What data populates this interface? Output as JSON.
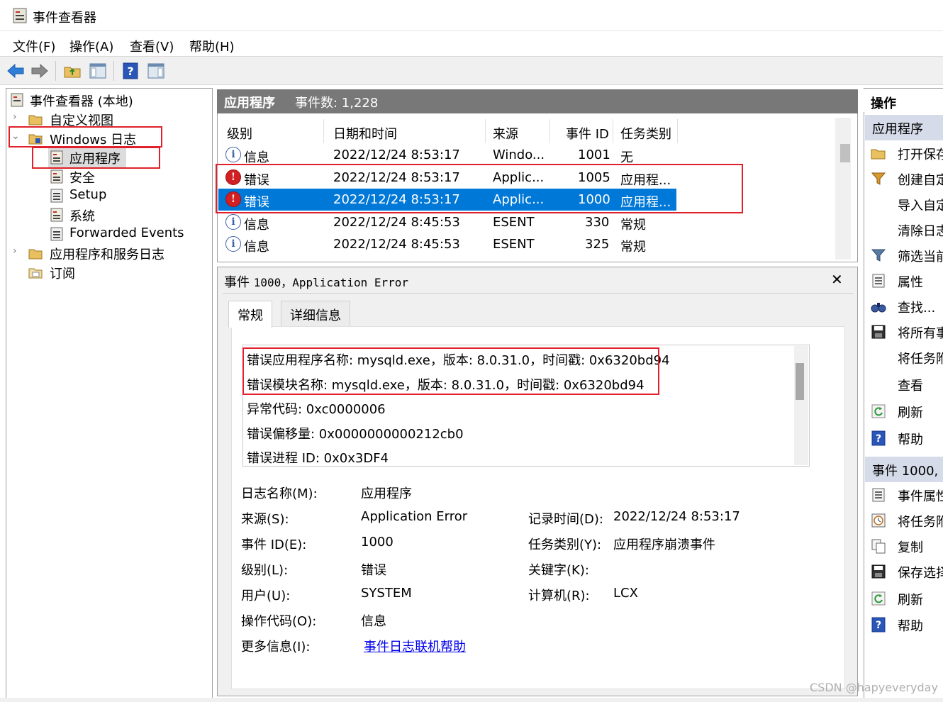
{
  "window": {
    "title": "事件查看器"
  },
  "menu": [
    "文件(F)",
    "操作(A)",
    "查看(V)",
    "帮助(H)"
  ],
  "toolbar": [
    "back-icon",
    "forward-icon",
    "up-folder-icon",
    "show-hide-console-tree-icon",
    "help-icon",
    "show-hide-action-pane-icon"
  ],
  "tree": {
    "root": "事件查看器 (本地)",
    "custom_views": "自定义视图",
    "windows_logs": "Windows 日志",
    "application": "应用程序",
    "security": "安全",
    "setup": "Setup",
    "system": "系统",
    "forwarded": "Forwarded Events",
    "app_service_logs": "应用程序和服务日志",
    "subscriptions": "订阅"
  },
  "list": {
    "title": "应用程序",
    "count": "事件数: 1,228",
    "columns": {
      "level": "级别",
      "datetime": "日期和时间",
      "source": "来源",
      "event_id": "事件 ID",
      "task": "任务类别"
    },
    "rows": [
      {
        "level": "信息",
        "datetime": "2022/12/24 8:53:17",
        "source": "Windo...",
        "event_id": "1001",
        "task": "无"
      },
      {
        "level": "错误",
        "datetime": "2022/12/24 8:53:17",
        "source": "Applic...",
        "event_id": "1005",
        "task": "应用程..."
      },
      {
        "level": "错误",
        "datetime": "2022/12/24 8:53:17",
        "source": "Applic...",
        "event_id": "1000",
        "task": "应用程..."
      },
      {
        "level": "信息",
        "datetime": "2022/12/24 8:45:53",
        "source": "ESENT",
        "event_id": "330",
        "task": "常规"
      },
      {
        "level": "信息",
        "datetime": "2022/12/24 8:45:53",
        "source": "ESENT",
        "event_id": "325",
        "task": "常规"
      }
    ]
  },
  "detail": {
    "title_prefix": "事件 ",
    "title_mono": "1000，Application Error",
    "tabs": {
      "general": "常规",
      "details": "详细信息"
    },
    "description": [
      "错误应用程序名称: mysqld.exe，版本: 8.0.31.0，时间戳: 0x6320bd94",
      "错误模块名称: mysqld.exe，版本: 8.0.31.0，时间戳: 0x6320bd94",
      "异常代码: 0xc0000006",
      "错误偏移量: 0x0000000000212cb0",
      "错误进程 ID: 0x0x3DF4"
    ],
    "props": {
      "log_name_label": "日志名称(M):",
      "log_name": "应用程序",
      "source_label": "来源(S):",
      "source": "Application Error",
      "logged_label": "记录时间(D):",
      "logged": "2022/12/24 8:53:17",
      "event_id_label": "事件 ID(E):",
      "event_id": "1000",
      "task_label": "任务类别(Y):",
      "task": "应用程序崩溃事件",
      "level_label": "级别(L):",
      "level": "错误",
      "keywords_label": "关键字(K):",
      "keywords": "",
      "user_label": "用户(U):",
      "user": "SYSTEM",
      "computer_label": "计算机(R):",
      "computer": "LCX",
      "opcode_label": "操作代码(O):",
      "opcode": "信息",
      "more_info_label": "更多信息(I):",
      "more_info": "事件日志联机帮助"
    }
  },
  "actions": {
    "header": "操作",
    "section1": "应用程序",
    "items1": [
      "打开保存",
      "创建自定",
      "导入自定",
      "清除日志",
      "筛选当前",
      "属性",
      "查找...",
      "将所有事",
      "将任务附",
      "查看",
      "刷新",
      "帮助"
    ],
    "section2": "事件 1000,",
    "items2": [
      "事件属性",
      "将任务附",
      "复制",
      "保存选择",
      "刷新",
      "帮助"
    ]
  },
  "watermark": "CSDN @hapyeveryday",
  "colors": {
    "selection": "#0078d7",
    "highlight_box": "#e0202a",
    "error_icon": "#d21f24",
    "info_icon": "#3b5fa7"
  }
}
